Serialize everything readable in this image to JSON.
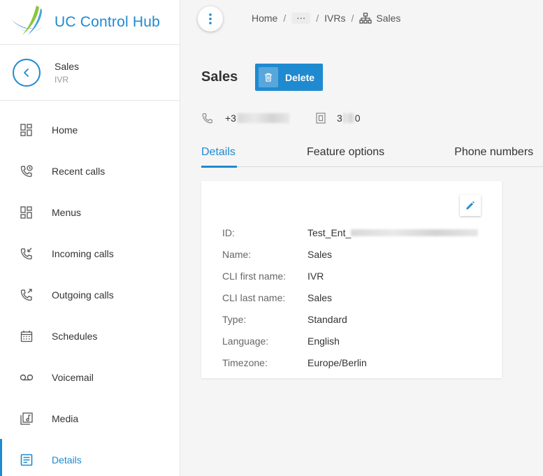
{
  "brand": {
    "title": "UC Control Hub"
  },
  "context": {
    "name": "Sales",
    "type": "IVR"
  },
  "nav": [
    {
      "label": "Home",
      "icon": "dashboard-icon"
    },
    {
      "label": "Recent calls",
      "icon": "recent-calls-icon"
    },
    {
      "label": "Menus",
      "icon": "menu-grid-icon"
    },
    {
      "label": "Incoming calls",
      "icon": "incoming-call-icon"
    },
    {
      "label": "Outgoing calls",
      "icon": "outgoing-call-icon"
    },
    {
      "label": "Schedules",
      "icon": "calendar-icon"
    },
    {
      "label": "Voicemail",
      "icon": "voicemail-icon"
    },
    {
      "label": "Media",
      "icon": "media-icon"
    },
    {
      "label": "Details",
      "icon": "details-icon"
    }
  ],
  "breadcrumb": {
    "home": "Home",
    "more": "···",
    "ivrs": "IVRs",
    "current": "Sales"
  },
  "page": {
    "title": "Sales",
    "delete_label": "Delete"
  },
  "info": {
    "phone_prefix": "+3",
    "extension_start": "3",
    "extension_end": "0"
  },
  "tabs": [
    "Details",
    "Feature options",
    "Phone numbers"
  ],
  "details": {
    "id_label": "ID:",
    "id_value": "Test_Ent_",
    "name_label": "Name:",
    "name_value": "Sales",
    "cli_first_label": "CLI first name:",
    "cli_first_value": "IVR",
    "cli_last_label": "CLI last name:",
    "cli_last_value": "Sales",
    "type_label": "Type:",
    "type_value": "Standard",
    "language_label": "Language:",
    "language_value": "English",
    "timezone_label": "Timezone:",
    "timezone_value": "Europe/Berlin"
  },
  "colors": {
    "accent": "#1f8ad0",
    "sidebar_bg": "#ffffff",
    "main_bg": "#f5f5f5"
  }
}
